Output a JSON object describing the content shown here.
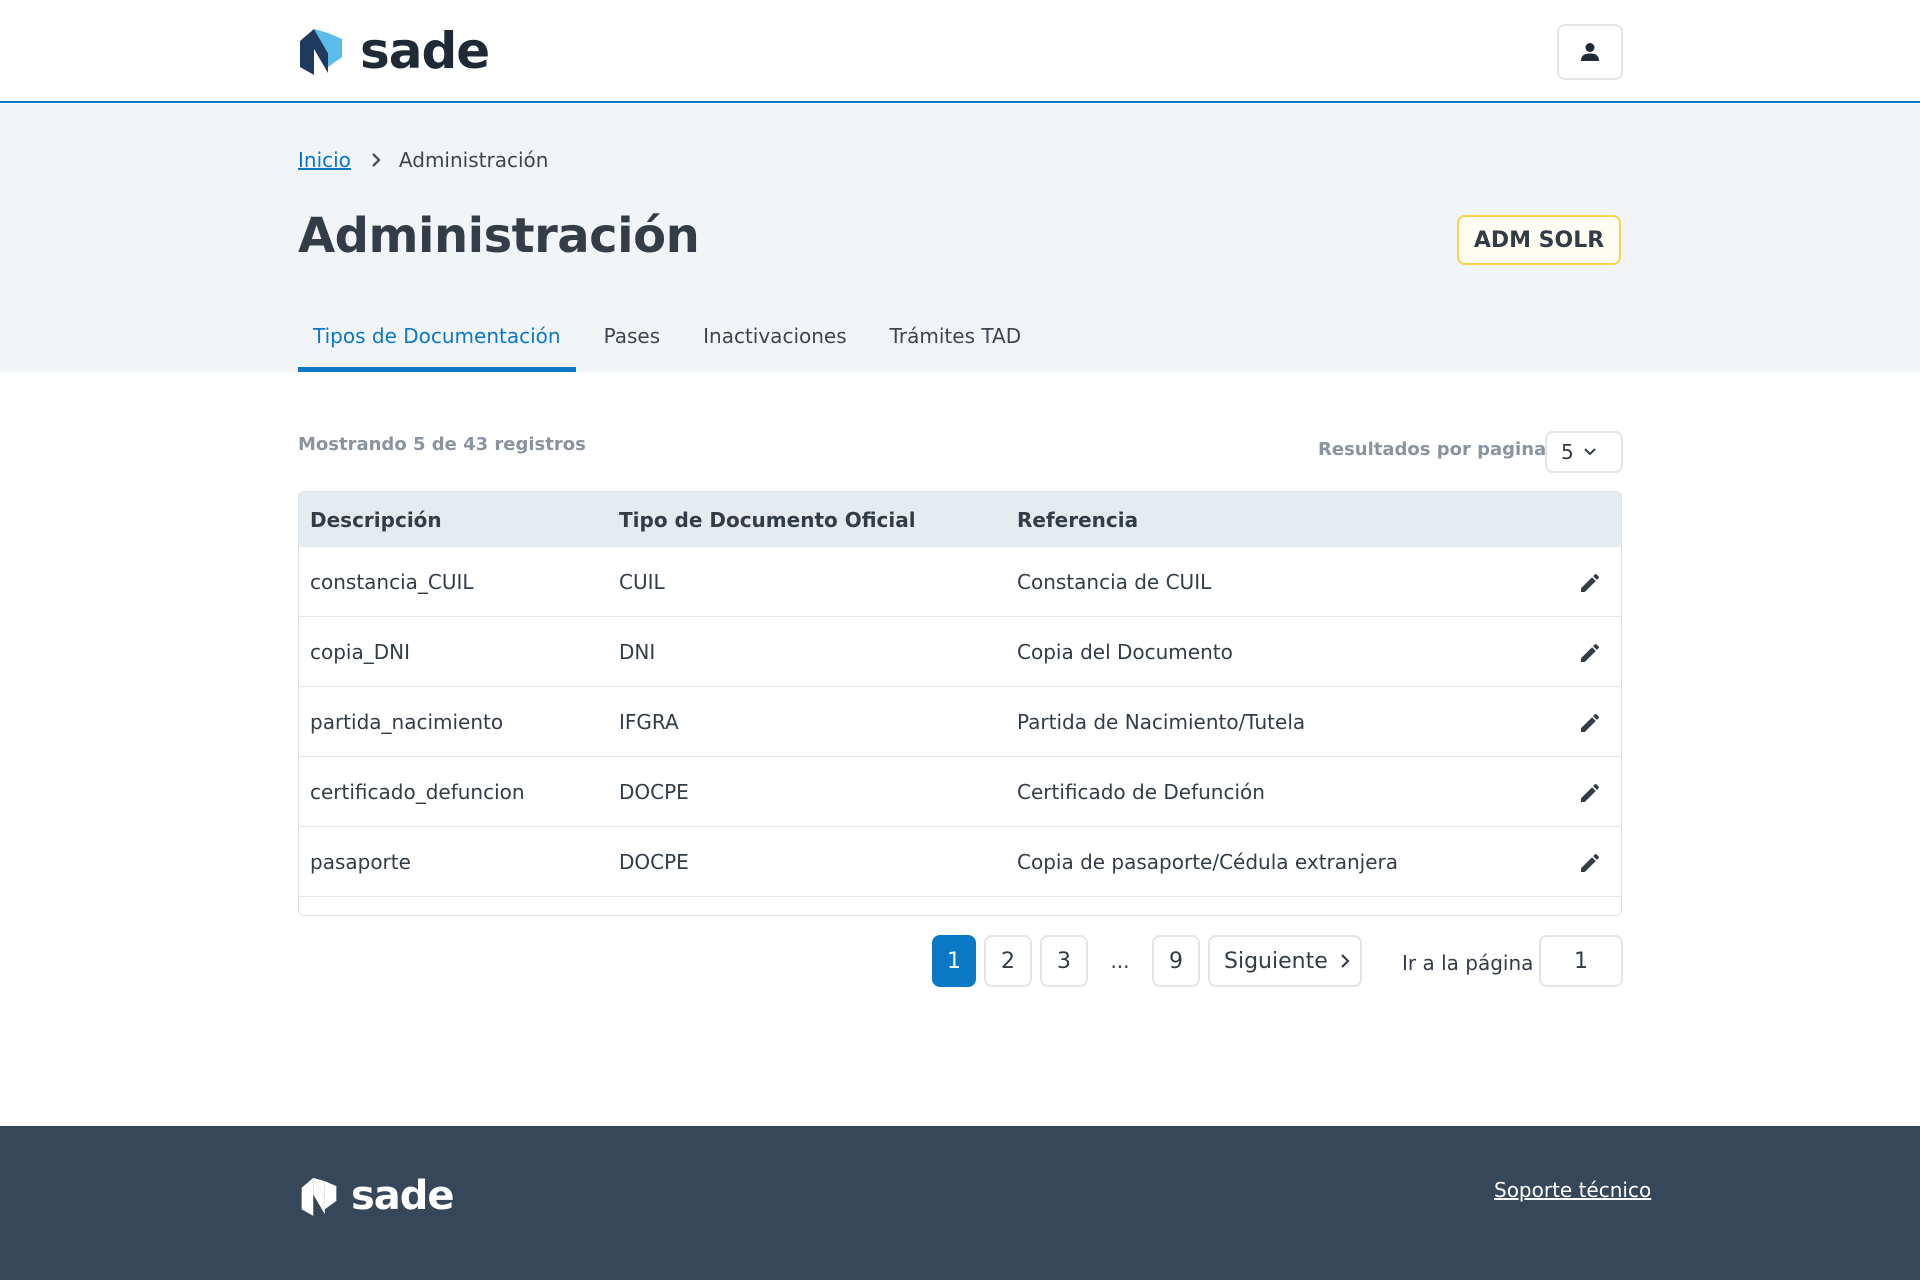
{
  "brand": {
    "name": "sade",
    "accent": "#0a78c4",
    "logo_dark": "#1f3a5c",
    "logo_light": "#5bbcea"
  },
  "header": {
    "user_icon": "user-icon"
  },
  "breadcrumb": {
    "home": "Inicio",
    "current": "Administración"
  },
  "page": {
    "title": "Administración",
    "role_badge": "ADM SOLR"
  },
  "tabs": [
    {
      "label": "Tipos de Documentación",
      "active": true
    },
    {
      "label": "Pases",
      "active": false
    },
    {
      "label": "Inactivaciones",
      "active": false
    },
    {
      "label": "Trámites TAD",
      "active": false
    }
  ],
  "listing": {
    "records_info": "Mostrando 5 de 43 registros",
    "per_page_label": "Resultados por pagina",
    "per_page_value": "5"
  },
  "table": {
    "headers": [
      "Descripción",
      "Tipo de Documento Oficial",
      "Referencia"
    ],
    "rows": [
      [
        "constancia_CUIL",
        "CUIL",
        "Constancia de CUIL"
      ],
      [
        "copia_DNI",
        "DNI",
        "Copia del Documento"
      ],
      [
        "partida_nacimiento",
        "IFGRA",
        "Partida de Nacimiento/Tutela"
      ],
      [
        "certificado_defuncion",
        "DOCPE",
        "Certificado de Defunción"
      ],
      [
        "pasaporte",
        "DOCPE",
        "Copia de pasaporte/Cédula extranjera"
      ]
    ],
    "row_action_icon": "pencil-edit-icon"
  },
  "pagination": {
    "pages": [
      "1",
      "2",
      "3"
    ],
    "ellipsis": "...",
    "last": "9",
    "current": "1",
    "next_label": "Siguiente",
    "goto_label": "Ir a la página",
    "goto_value": "1"
  },
  "footer": {
    "brand": "sade",
    "support_link": "Soporte técnico",
    "background": "#37475a"
  }
}
